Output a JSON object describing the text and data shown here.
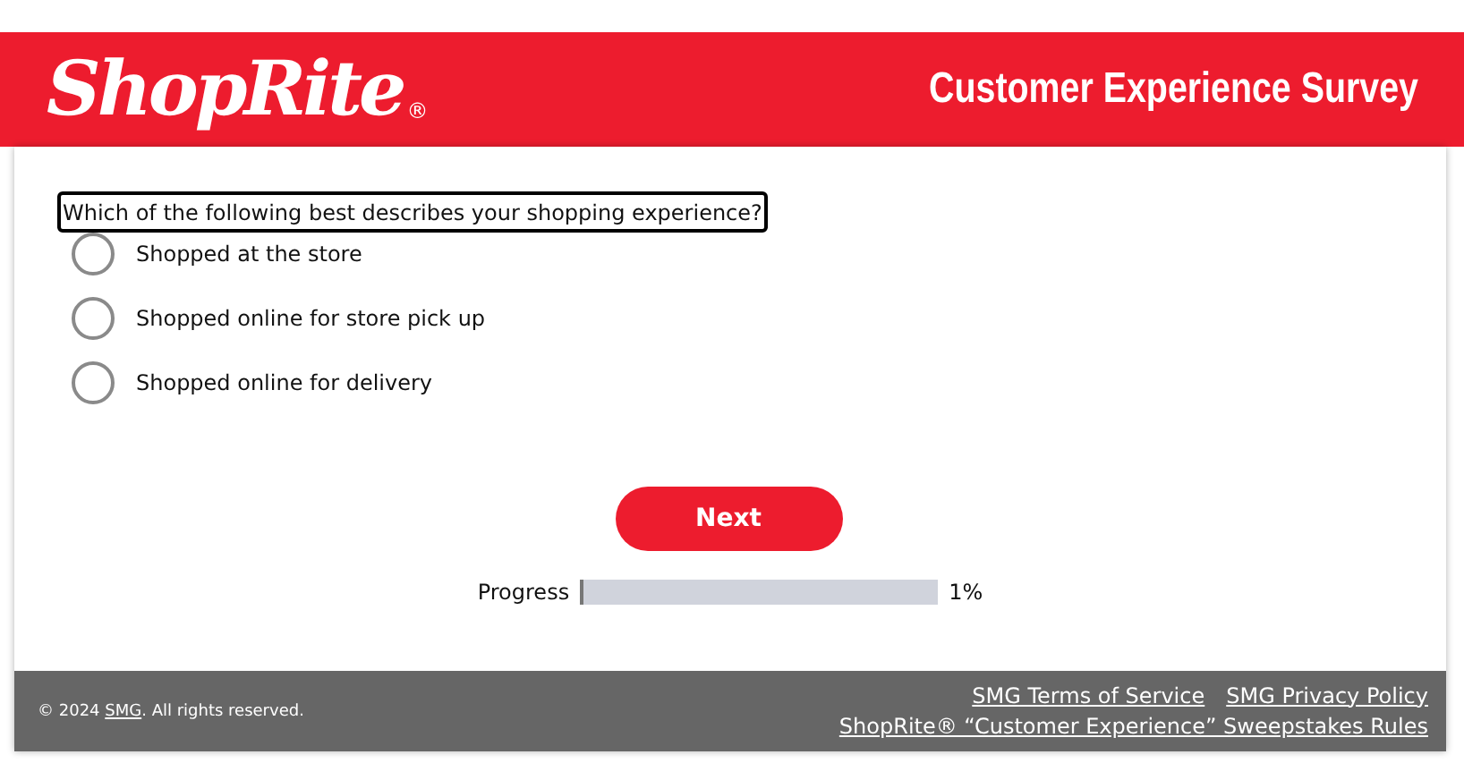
{
  "header": {
    "logo": "ShopRite",
    "logo_mark": "®",
    "title": "Customer Experience Survey"
  },
  "question": {
    "text": "Which of the following best describes your shopping experience?",
    "options": [
      {
        "label": "Shopped at the store",
        "selected": false
      },
      {
        "label": "Shopped online for store pick up",
        "selected": false
      },
      {
        "label": "Shopped online for delivery",
        "selected": false
      }
    ]
  },
  "next_button": "Next",
  "progress": {
    "label": "Progress",
    "level": 0.01,
    "reading": "1%"
  },
  "footer": {
    "copyright": {
      "before": "© 2024 ",
      "link": "SMG",
      "after": ". All rights reserved."
    },
    "links": [
      "SMG Terms of Service",
      "SMG Privacy Policy",
      "ShopRite® “Customer Experience” Sweepstakes Rules"
    ]
  }
}
